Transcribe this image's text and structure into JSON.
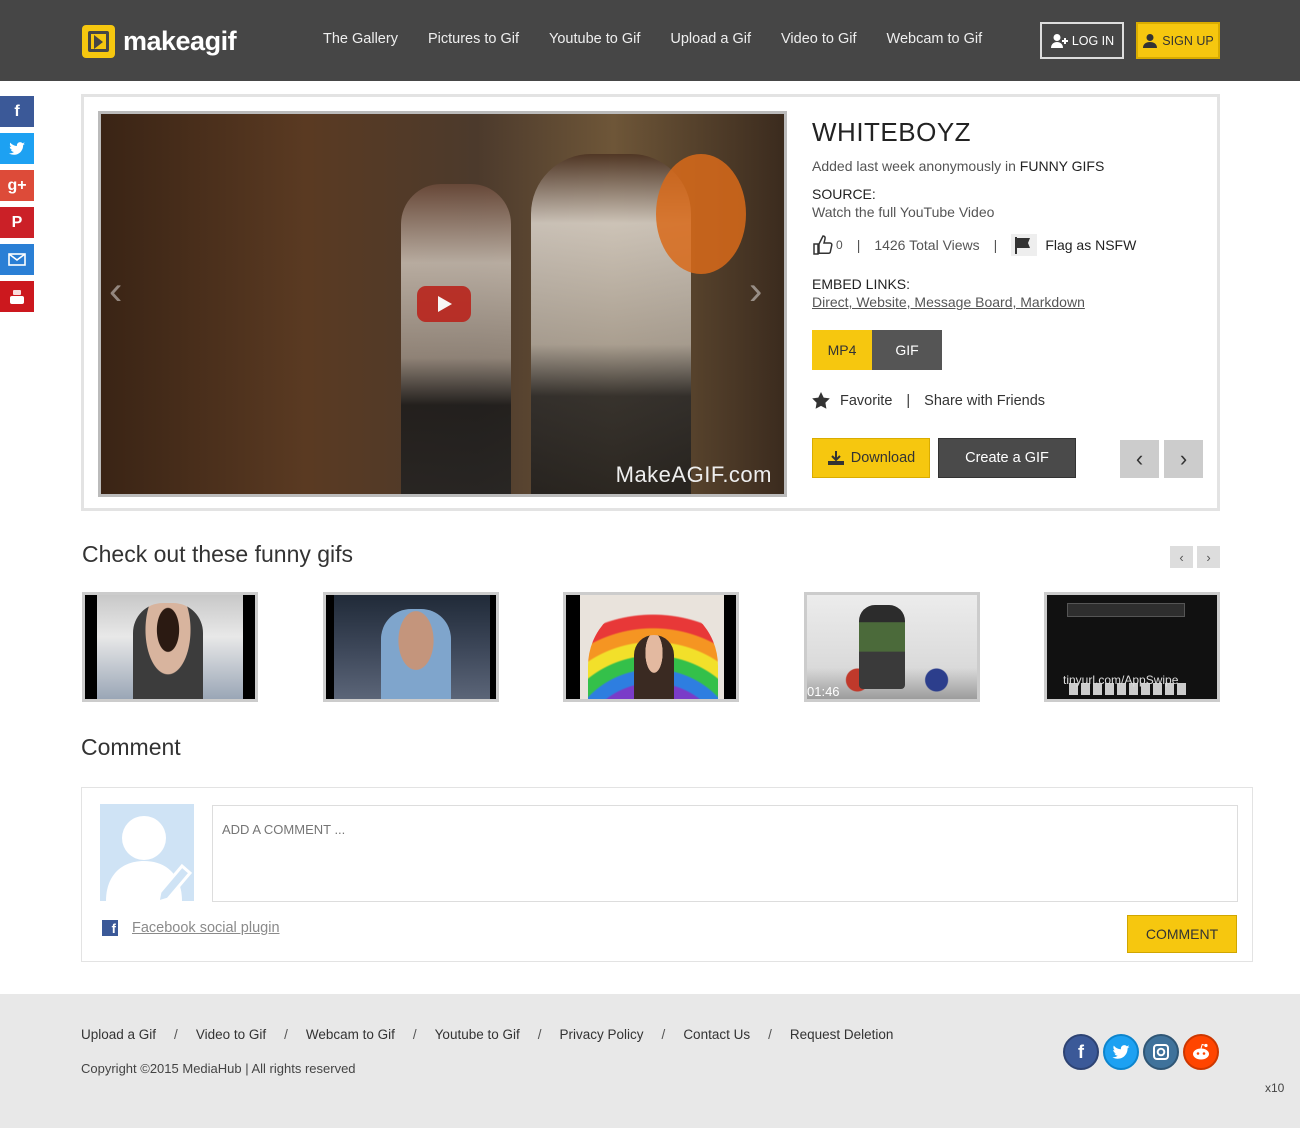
{
  "header": {
    "logo_text": "makeagif",
    "nav": [
      "The Gallery",
      "Pictures to Gif",
      "Youtube to Gif",
      "Upload a Gif",
      "Video to Gif",
      "Webcam to Gif"
    ],
    "login_label": "LOG IN",
    "signup_label": "SIGN UP"
  },
  "gif": {
    "title": "WHITEBOYZ",
    "added_prefix": "Added last week anonymously in",
    "category": "FUNNY GIFS",
    "source_heading": "SOURCE:",
    "source_value": "Watch the full YouTube Video",
    "likes": "0",
    "views": "1426 Total Views",
    "flag_label": "Flag as NSFW",
    "embed_heading": "EMBED LINKS:",
    "embed_links": "Direct, Website, Message Board, Markdown",
    "format_mp4": "MP4",
    "format_gif": "GIF",
    "favorite_label": "Favorite",
    "share_label": "Share with Friends",
    "download_label": "Download",
    "create_label": "Create a GIF",
    "watermark": "MakeAGIF.com"
  },
  "related": {
    "heading": "Check out these funny gifs",
    "thumb4_caption": "01:46",
    "thumb5_caption": "tinyurl.com/AppSwipe"
  },
  "comment": {
    "heading": "Comment",
    "placeholder": "ADD A COMMENT ...",
    "fb_plugin": "Facebook social plugin",
    "submit_label": "COMMENT"
  },
  "footer": {
    "links": [
      "Upload a Gif",
      "Video to Gif",
      "Webcam to Gif",
      "Youtube to Gif",
      "Privacy Policy",
      "Contact Us",
      "Request Deletion"
    ],
    "copyright": "Copyright ©2015 MediaHub | All rights reserved",
    "badge": "x10"
  },
  "colors": {
    "header_bg": "#464646",
    "accent_yellow": "#f6c70f",
    "facebook": "#3b5998",
    "twitter": "#1da1f2",
    "google_plus": "#dd4b39",
    "pinterest": "#cb2027",
    "email": "#2a7fd5",
    "youtube": "#cc181e",
    "instagram": "#3f729b",
    "reddit": "#ff4500"
  },
  "icons": {
    "side": [
      "facebook-icon",
      "twitter-icon",
      "google-plus-icon",
      "pinterest-icon",
      "email-icon",
      "youtube-icon"
    ],
    "footer": [
      "facebook-icon",
      "twitter-icon",
      "instagram-icon",
      "reddit-icon"
    ]
  }
}
